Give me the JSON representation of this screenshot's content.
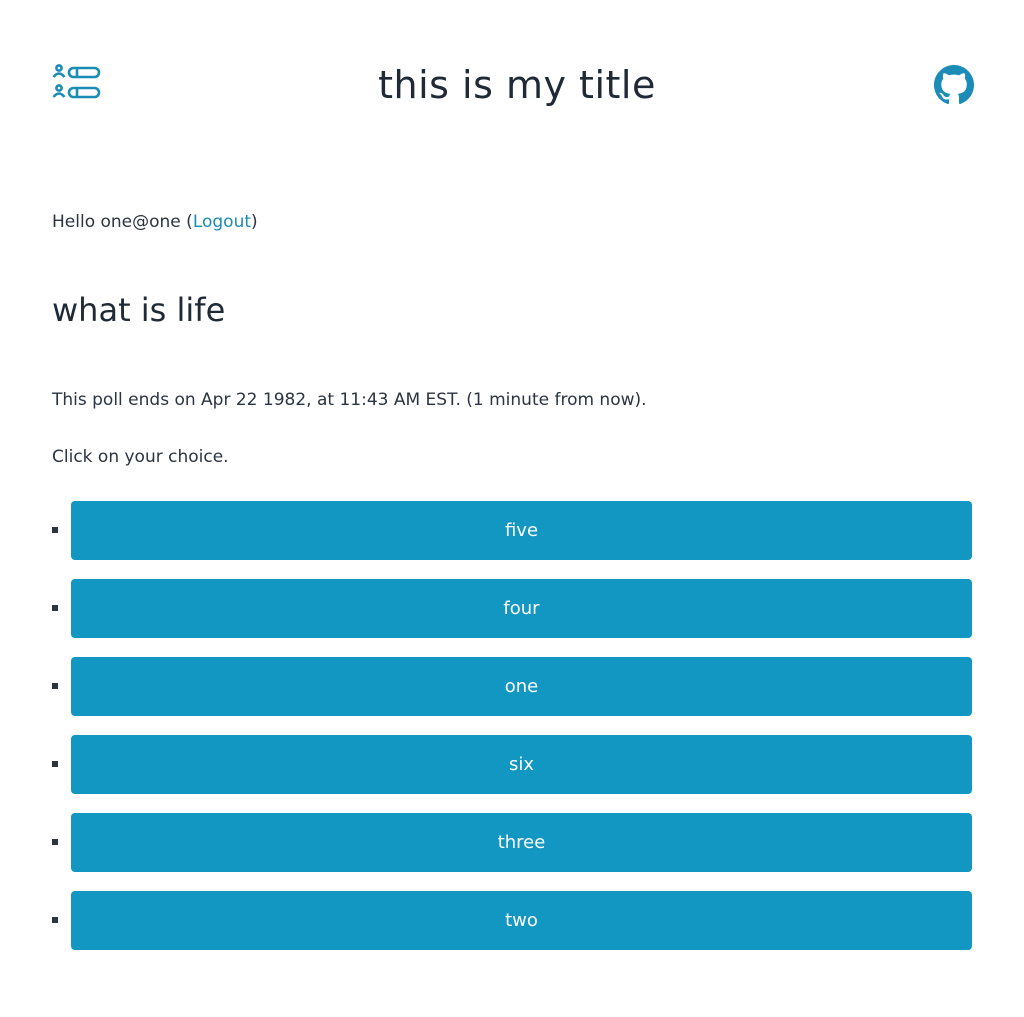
{
  "header": {
    "title": "this is my title",
    "logo_icon": "poll-list-icon",
    "github_icon": "github-icon",
    "accent_color": "#1296c2"
  },
  "greeting": {
    "prefix": "Hello one@one (",
    "logout_label": "Logout",
    "suffix": ")"
  },
  "poll": {
    "title": "what is life",
    "ends_text": "This poll ends on Apr 22 1982, at 11:43 AM EST. (1 minute from now).",
    "instruction": "Click on your choice.",
    "choices": [
      "five",
      "four",
      "one",
      "six",
      "three",
      "two"
    ]
  }
}
